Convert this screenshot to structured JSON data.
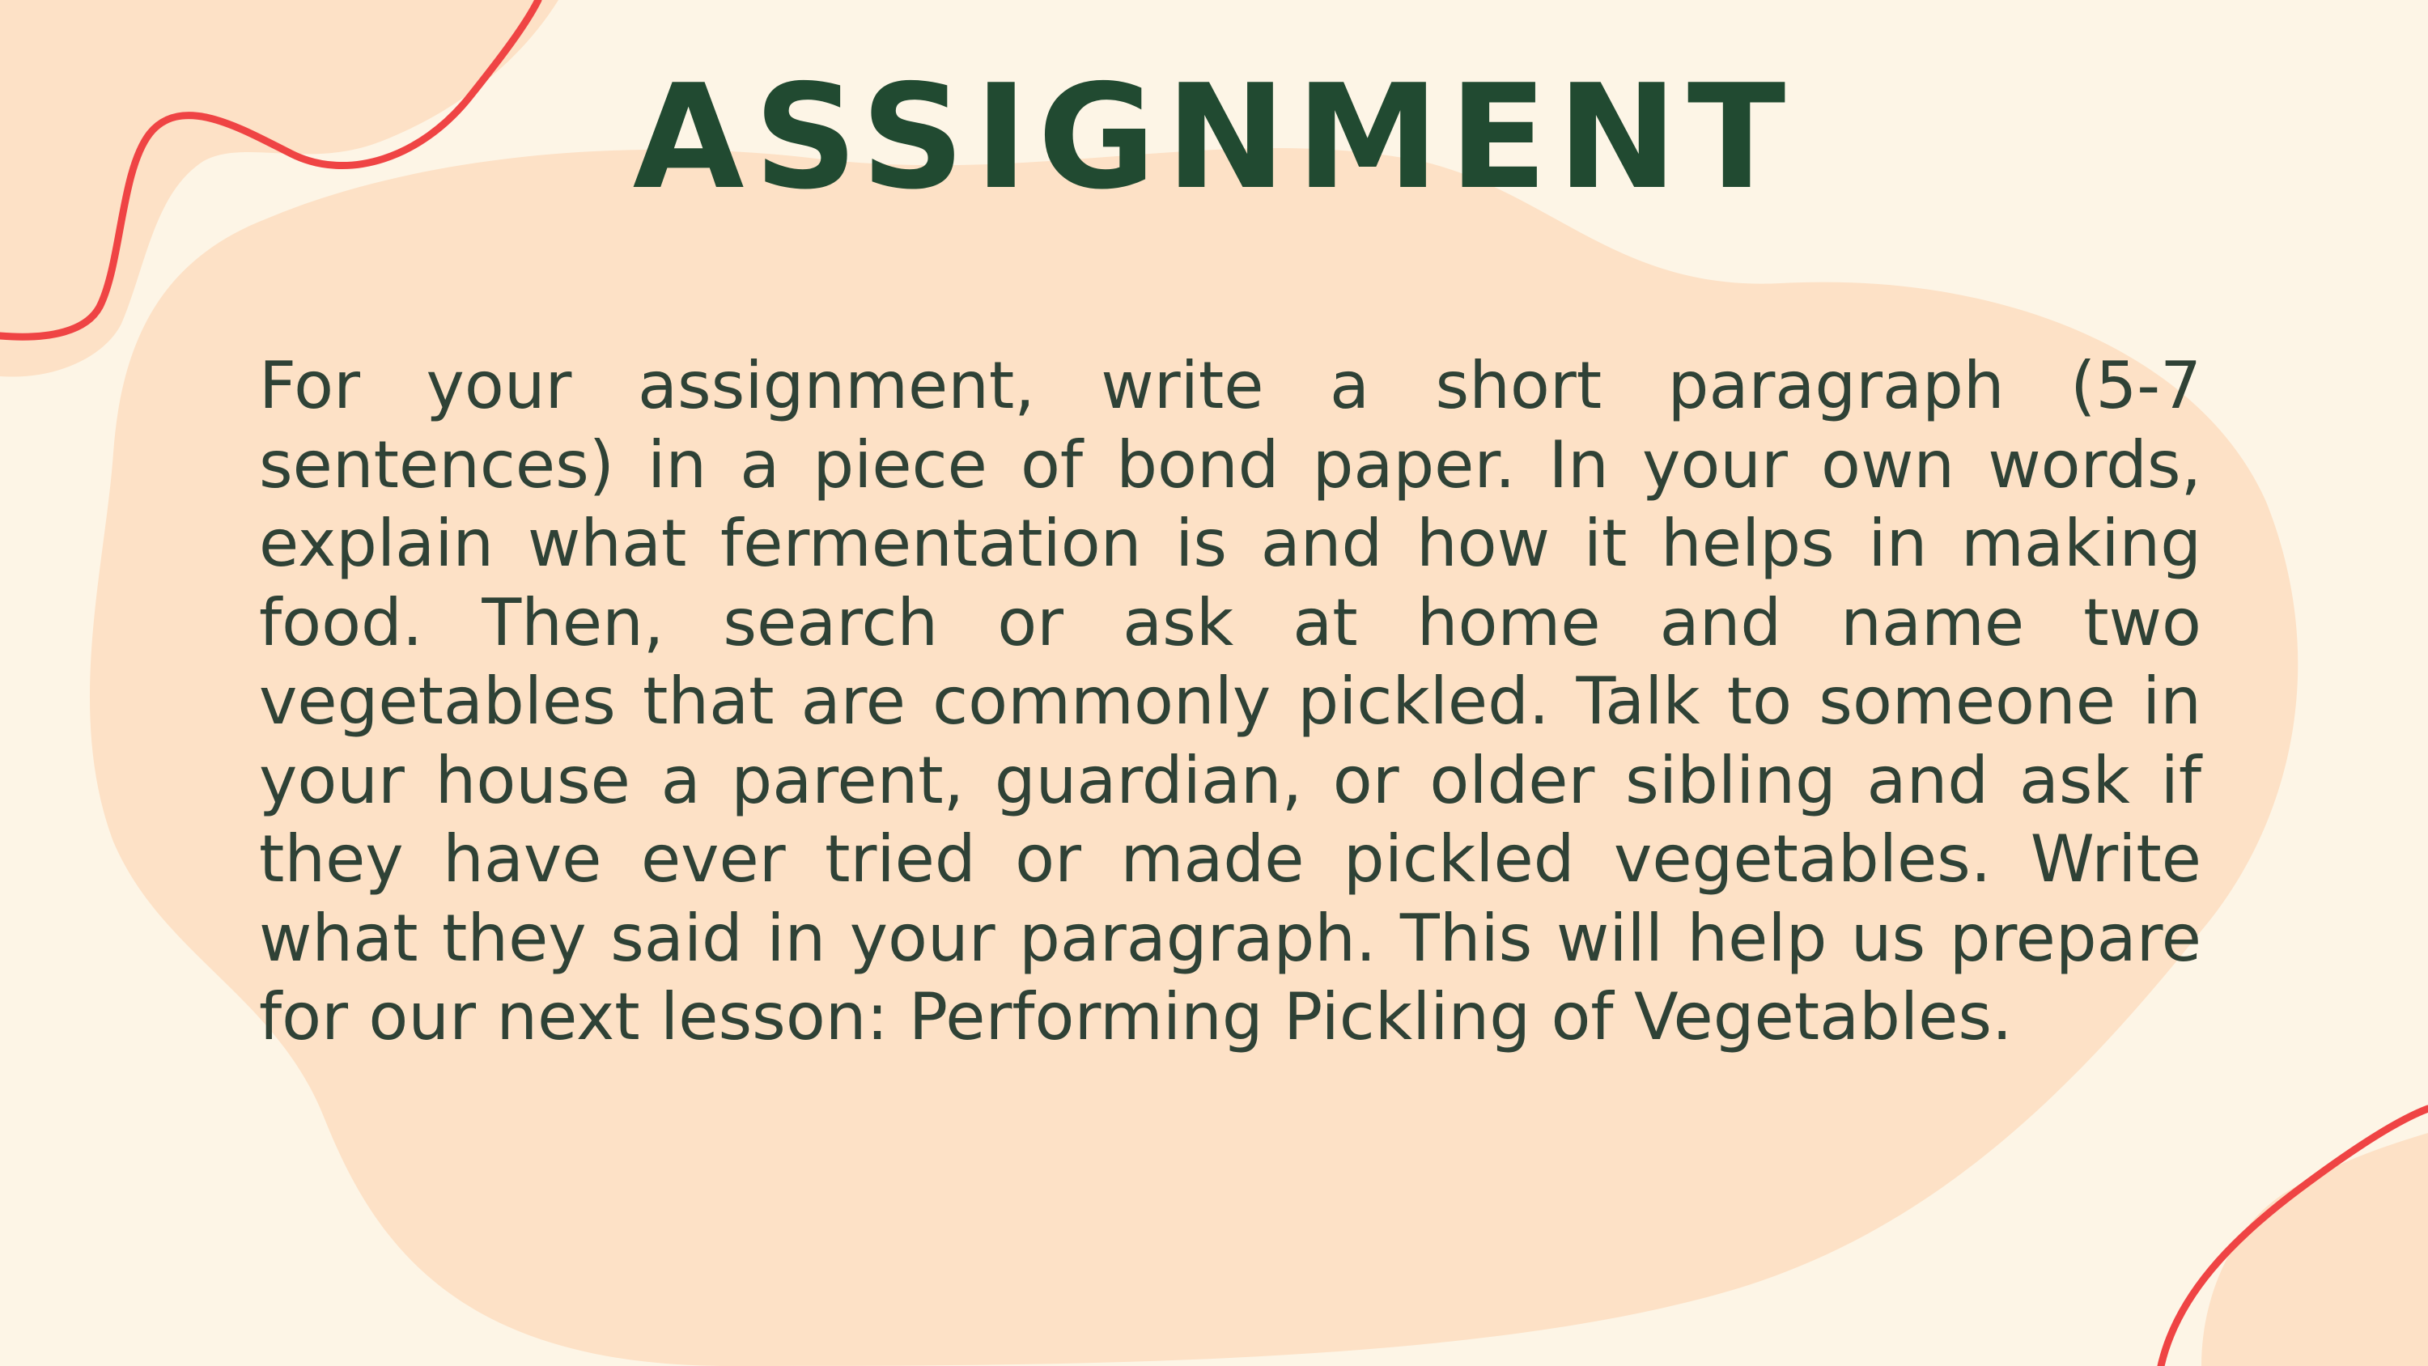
{
  "slide": {
    "title": "ASSIGNMENT",
    "body": "For your assignment, write a short paragraph (5-7 sentences) in a piece of bond paper. In your own words, explain what fermentation is and how it helps in making food. Then, search or ask at home and name two vegetables that are commonly pickled. Talk to someone in your house a parent, guardian, or older sibling and ask if they have ever tried or made pickled vegetables. Write what they said in your paragraph. This will help us prepare for our next lesson: Performing Pickling of Vegetables."
  },
  "colors": {
    "background": "#fdf5e6",
    "blob": "#fde1c6",
    "accent_line": "#ef4444",
    "title": "#214a31",
    "body_text": "#2f4236"
  }
}
